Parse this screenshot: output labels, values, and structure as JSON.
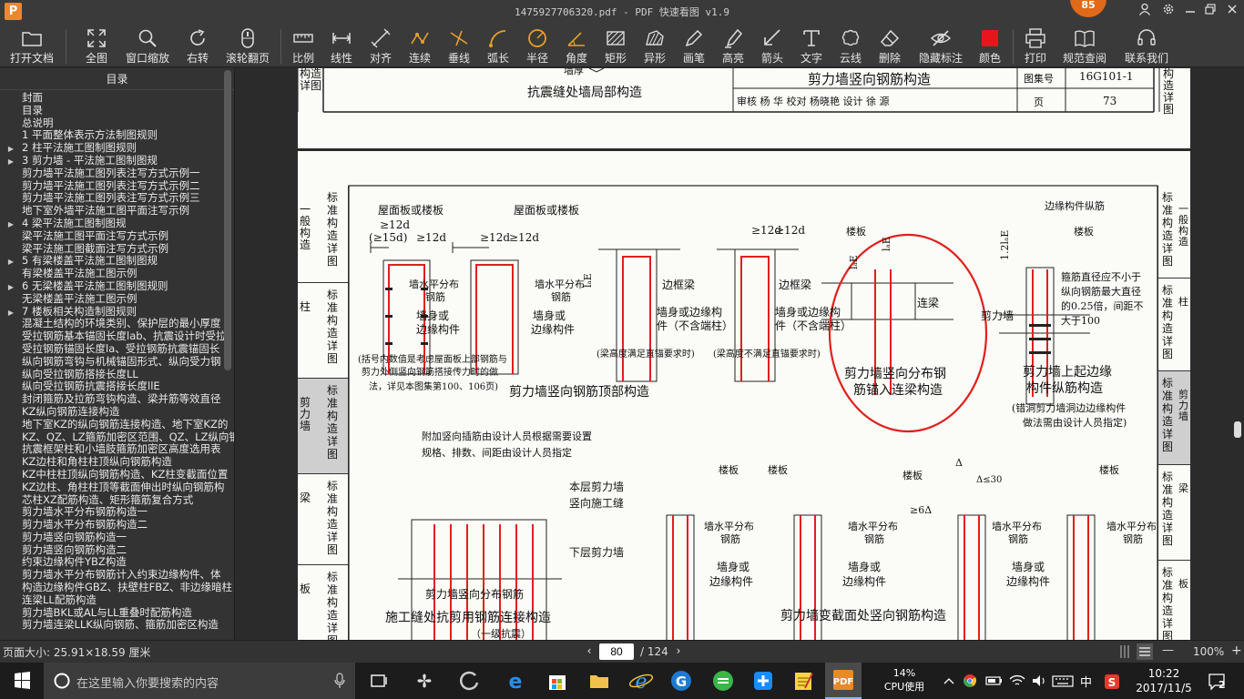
{
  "window": {
    "title": "1475927706320.pdf - PDF 快速看图 v1.9",
    "badge_count": "85"
  },
  "toolbar": [
    {
      "key": "open",
      "label": "打开文档"
    },
    {
      "key": "fit",
      "label": "全图"
    },
    {
      "key": "zoom_window",
      "label": "窗口缩放"
    },
    {
      "key": "rotate",
      "label": "右转"
    },
    {
      "key": "scroll_page",
      "label": "滚轮翻页"
    },
    {
      "key": "scale",
      "label": "比例"
    },
    {
      "key": "linear",
      "label": "线性"
    },
    {
      "key": "align",
      "label": "对齐"
    },
    {
      "key": "continuous",
      "label": "连续"
    },
    {
      "key": "perpendicular",
      "label": "垂线"
    },
    {
      "key": "arc_length",
      "label": "弧长"
    },
    {
      "key": "radius",
      "label": "半径"
    },
    {
      "key": "angle",
      "label": "角度"
    },
    {
      "key": "rectangle",
      "label": "矩形"
    },
    {
      "key": "irregular",
      "label": "异形"
    },
    {
      "key": "pen",
      "label": "画笔"
    },
    {
      "key": "highlight",
      "label": "高亮"
    },
    {
      "key": "arrow",
      "label": "箭头"
    },
    {
      "key": "text",
      "label": "文字"
    },
    {
      "key": "cloud",
      "label": "云线"
    },
    {
      "key": "delete",
      "label": "删除"
    },
    {
      "key": "hide_marks",
      "label": "隐藏标注"
    },
    {
      "key": "color",
      "label": "颜色"
    },
    {
      "key": "print",
      "label": "打印"
    },
    {
      "key": "spec_lookup",
      "label": "规范查阅"
    },
    {
      "key": "contact",
      "label": "联系我们"
    }
  ],
  "colors": {
    "markup_red": "#e0201c",
    "accent_orange": "#e06a1a"
  },
  "sidebar": {
    "title": "目录",
    "items": [
      {
        "label": "封面",
        "level": 0
      },
      {
        "label": "目录",
        "level": 0
      },
      {
        "label": "总说明",
        "level": 0
      },
      {
        "label": "1 平面整体表示方法制图规则",
        "level": 0
      },
      {
        "label": "2 柱平法施工图制图规则",
        "level": 1,
        "arrow": "▶"
      },
      {
        "label": "3 剪力墙 - 平法施工图制图规",
        "level": 1,
        "arrow": "▶"
      },
      {
        "label": "剪力墙平法施工图列表注写方式示例一",
        "level": 0
      },
      {
        "label": "剪力墙平法施工图列表注写方式示例二",
        "level": 0
      },
      {
        "label": "剪力墙平法施工图列表注写方式示例三",
        "level": 0
      },
      {
        "label": "地下室外墙平法施工图平面注写示例",
        "level": 0
      },
      {
        "label": "4 梁平法施工图制图规",
        "level": 1,
        "arrow": "▶"
      },
      {
        "label": "梁平法施工图平面注写方式示例",
        "level": 0
      },
      {
        "label": "梁平法施工图截面注写方式示例",
        "level": 0
      },
      {
        "label": "5 有梁楼盖平法施工图制图规",
        "level": 1,
        "arrow": "▶"
      },
      {
        "label": "有梁楼盖平法施工图示例",
        "level": 0
      },
      {
        "label": "6 无梁楼盖平法施工图制图规则",
        "level": 1,
        "arrow": "▶"
      },
      {
        "label": "无梁楼盖平法施工图示例",
        "level": 0
      },
      {
        "label": "7 楼板相关构造制图规则",
        "level": 1,
        "arrow": "▶"
      },
      {
        "label": "混凝土结构的环境类别、保护层的最小厚度",
        "level": 0
      },
      {
        "label": "受拉钢筋基本锚固长度lab、抗震设计时受拉",
        "level": 0
      },
      {
        "label": "受拉钢筋锚固长度la、受拉钢筋抗震锚固长",
        "level": 0
      },
      {
        "label": "纵向钢筋弯钩与机械锚固形式、纵向受力钢",
        "level": 0
      },
      {
        "label": "纵向受拉钢筋搭接长度LL",
        "level": 0
      },
      {
        "label": "纵向受拉钢筋抗震搭接长度llE",
        "level": 0
      },
      {
        "label": "封闭箍筋及拉筋弯钩构造、梁并筋等效直径",
        "level": 0
      },
      {
        "label": "KZ纵向钢筋连接构造",
        "level": 0
      },
      {
        "label": "地下室KZ的纵向钢筋连接构造、地下室KZ的",
        "level": 0
      },
      {
        "label": "KZ、QZ、LZ箍筋加密区范围、QZ、LZ纵向钢",
        "level": 0
      },
      {
        "label": "抗震框架柱和小墙肢箍筋加密区高度选用表",
        "level": 0
      },
      {
        "label": "KZ边柱和角柱柱顶纵向钢筋构造",
        "level": 0
      },
      {
        "label": "KZ中柱柱顶纵向钢筋构造、KZ柱变截面位置",
        "level": 0
      },
      {
        "label": "KZ边柱、角柱柱顶等截面伸出时纵向钢筋构",
        "level": 0
      },
      {
        "label": "芯柱XZ配筋构造、矩形箍筋复合方式",
        "level": 0
      },
      {
        "label": "剪力墙水平分布钢筋构造一",
        "level": 0
      },
      {
        "label": "剪力墙水平分布钢筋构造二",
        "level": 0
      },
      {
        "label": "剪力墙竖向钢筋构造一",
        "level": 0
      },
      {
        "label": "剪力墙竖向钢筋构造二",
        "level": 0
      },
      {
        "label": "约束边缘构件YBZ构造",
        "level": 0
      },
      {
        "label": "剪力墙水平分布钢筋计入约束边缘构件、体",
        "level": 0
      },
      {
        "label": "构造边缘构件GBZ、扶壁柱FBZ、非边缘暗柱",
        "level": 0
      },
      {
        "label": "连梁LL配筋构造",
        "level": 0
      },
      {
        "label": "剪力墙BKL或AL与LL重叠时配筋构造",
        "level": 0
      },
      {
        "label": "剪力墙连梁LLK纵向钢筋、箍筋加密区构造",
        "level": 0
      }
    ]
  },
  "page_top": {
    "left_tab": "构造详图",
    "caption": "抗震缝处墙局部构造",
    "header_title": "剪力墙竖向钢筋构造",
    "atlas_label": "图集号",
    "atlas_no": "16G101-1",
    "page_label": "页",
    "page_no": "73",
    "review_row": "审核 杨 华 校对 杨晓艳 设计 徐 源",
    "right_tab": "构造详图",
    "clip_text": "墙厚"
  },
  "page_main": {
    "left_tabs": [
      {
        "lines": [
          "标准构造详图"
        ],
        "side": "一般构造"
      },
      {
        "lines": [
          "标准构造详图"
        ],
        "side": "柱"
      },
      {
        "lines": [
          "标准构造详图"
        ],
        "side": "剪力墙",
        "active": true
      },
      {
        "lines": [
          "标准构造详图"
        ],
        "side": "梁"
      },
      {
        "lines": [
          "标准构造详图"
        ],
        "side": "板"
      }
    ],
    "right_tabs": [
      {
        "label": "标准构造详图",
        "side": "一般构造"
      },
      {
        "label": "标准构造详图",
        "side": "柱"
      },
      {
        "label": "标准构造详图",
        "side": "剪力墙",
        "active": true
      },
      {
        "label": "标准构造详图",
        "side": "梁"
      },
      {
        "label": "标准构造详图",
        "side": "板"
      }
    ],
    "texts": {
      "roof_slab_1": "屋面板或楼板",
      "roof_slab_2": "屋面板或楼板",
      "d12a": "≥12d",
      "d15": "(≥15d)",
      "d12b": "≥12d",
      "d12c": "≥12d",
      "d12d": "≥12d",
      "d12e": "≥12d",
      "d12f": "≥12d",
      "horiz_bar_1": "墙水平分布",
      "horiz_bar_1b": "钢筋",
      "horiz_bar_2": "墙水平分布",
      "horiz_bar_2b": "钢筋",
      "wall_edge_1": "墙身或",
      "wall_edge_1b": "边缘构件",
      "wall_edge_2": "墙身或",
      "wall_edge_2b": "边缘构件",
      "frame_beam_1": "边框梁",
      "frame_beam_2": "边框梁",
      "wall_edge_3": "墙身或边缘构",
      "wall_edge_3b": "件（不含端柱）",
      "wall_edge_4": "墙身或边缘构",
      "wall_edge_4b": "件（不含端柱）",
      "beam_note_1": "(梁高度满足直锚要求时)",
      "beam_note_2": "(梁高度不满足直锚要求时)",
      "note_1": "(括号内数值是考虑屋面板上部钢筋与",
      "note_2": "剪力外侧竖向钢筋搭接传力时的做",
      "note_3": "法，详见本图集第100、106页)",
      "title_top": "剪力墙竖向钢筋顶部构造",
      "lae_1": "lₐE",
      "lae_2": "lₐE",
      "floor_slab_1": "楼板",
      "coupling_beam": "连梁",
      "lae_3": "lₐE",
      "title_anchor_1": "剪力墙竖向分布钢",
      "title_anchor_2": "筋锚入连梁构造",
      "edge_long": "边缘构件纵筋",
      "floor_slab_2": "楼板",
      "stirrup_1": "箍筋直径应不小于",
      "stirrup_2": "纵向钢筋最大直径",
      "stirrup_3": "的0.25倍，间距不",
      "stirrup_4": "大于100",
      "shear_wall": "剪力墙",
      "l12": "1.2lₐE",
      "title_edge_1": "剪力墙上起边缘",
      "title_edge_2": "构件纵筋构造",
      "edge_note_1": "(错洞剪力墙洞边边缘构件",
      "edge_note_2": "做法需由设计人员指定)",
      "add_bar_1": "附加竖向插筋由设计人员根据需要设置",
      "add_bar_2": "规格、排数、间距由设计人员指定",
      "this_wall": "本层剪力墙",
      "joint": "竖向施工缝",
      "lower_wall": "下层剪力墙",
      "vert_bar": "剪力墙竖向分布钢筋",
      "title_joint": "施工缝处抗剪用钢筋连接构造",
      "title_joint_sub": "（一级抗震）",
      "slab_a": "楼板",
      "slab_b": "楼板",
      "slab_c": "楼板",
      "slab_d": "楼板",
      "horiz_a": "墙水平分布",
      "horiz_ab": "钢筋",
      "horiz_b": "墙水平分布",
      "horiz_bb": "钢筋",
      "horiz_c": "墙水平分布",
      "horiz_cb": "钢筋",
      "horiz_d": "墙水平分布",
      "horiz_db": "钢筋",
      "edge_a": "墙身或",
      "edge_ab": "边缘构件",
      "edge_b": "墙身或",
      "edge_bb": "边缘构件",
      "edge_c": "墙身或",
      "edge_cb": "边缘构件",
      "delta": "Δ",
      "delta_le": "Δ≤30",
      "delta6": "≥6Δ",
      "title_section": "剪力墙变截面处竖向钢筋构造"
    }
  },
  "status": {
    "page_size": "页面大小: 25.91×18.59 厘米",
    "current_page": "80",
    "total_pages": "/ 124",
    "zoom": "100%"
  },
  "taskbar": {
    "search_placeholder": "在这里输入你要搜索的内容",
    "cpu_value": "14%",
    "cpu_label": "CPU使用",
    "ime": "中",
    "time": "10:22",
    "date": "2017/11/5",
    "notification_count": "2"
  }
}
